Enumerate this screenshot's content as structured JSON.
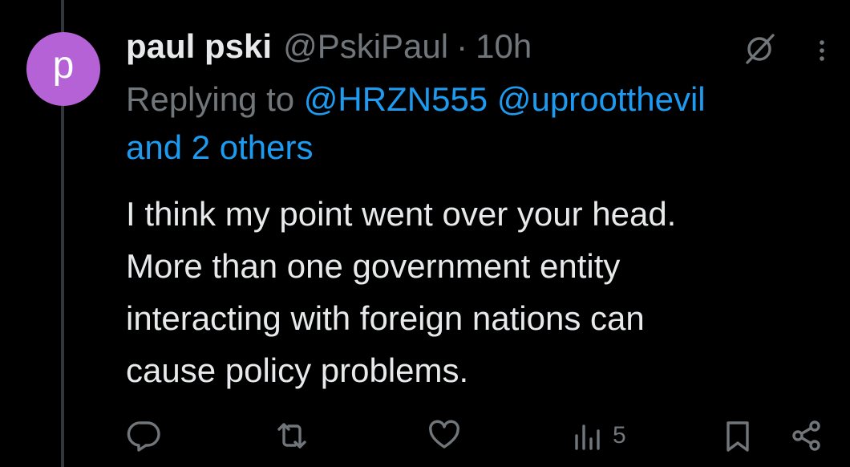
{
  "author": {
    "avatar_letter": "p",
    "avatar_color": "#b562d6",
    "name": "paul pski",
    "handle": "@PskiPaul",
    "separator": "·",
    "time": "10h"
  },
  "reply": {
    "prefix": "Replying to",
    "mention_1": "@HRZN555",
    "mention_2": "@uprootthevil",
    "others": "and 2 others"
  },
  "body": {
    "line_1": "I think my point went over your head.",
    "line_2": "More than one government entity",
    "line_3": "interacting with foreign nations can",
    "line_4": "cause policy problems."
  },
  "actions": {
    "reply_icon": "reply-icon",
    "retweet_icon": "retweet-icon",
    "like_icon": "like-icon",
    "views_icon": "views-icon",
    "views_count": "5",
    "bookmark_icon": "bookmark-icon",
    "share_icon": "share-icon"
  },
  "colors": {
    "background": "#000000",
    "primary_text": "#e7e9ea",
    "secondary_text": "#71767b",
    "link": "#1d9bf0",
    "icon": "#71767b"
  }
}
